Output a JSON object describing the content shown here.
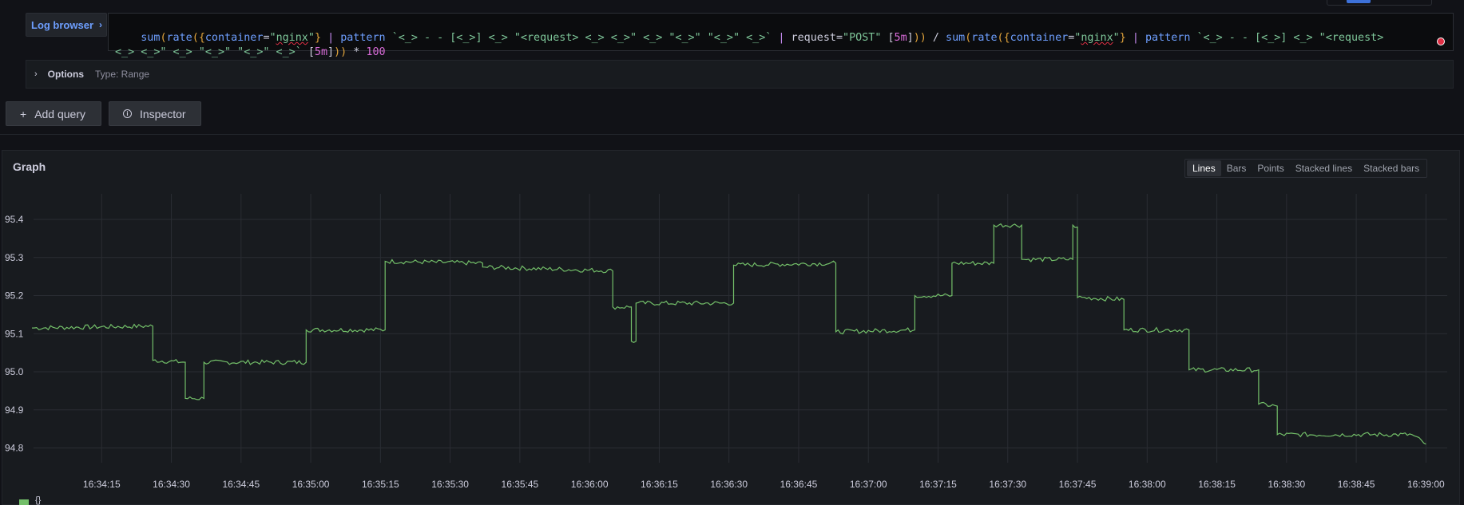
{
  "query": {
    "log_browser_label": "Log browser",
    "tokens": [
      [
        "t-fn",
        "sum"
      ],
      [
        "t-br",
        "("
      ],
      [
        "t-fn",
        "rate"
      ],
      [
        "t-br",
        "("
      ],
      [
        "t-br",
        "{"
      ],
      [
        "t-lbl",
        "container"
      ],
      [
        "t-op",
        "="
      ],
      [
        "t-str",
        "\""
      ],
      [
        "t-str t-err",
        "nginx"
      ],
      [
        "t-str",
        "\""
      ],
      [
        "t-br",
        "}"
      ],
      [
        "t-op",
        " "
      ],
      [
        "t-pipe",
        "|"
      ],
      [
        "t-op",
        " "
      ],
      [
        "t-kw",
        "pattern"
      ],
      [
        "t-op",
        " "
      ],
      [
        "t-str",
        "`<_> - - [<_>] <_> \"<request> <_> <_>\" <_> \"<_>\" \"<_>\" <_>`"
      ],
      [
        "t-op",
        " "
      ],
      [
        "t-pipe",
        "|"
      ],
      [
        "t-op",
        " request="
      ],
      [
        "t-str",
        "\"POST\""
      ],
      [
        "t-op",
        " "
      ],
      [
        "t-brk",
        "["
      ],
      [
        "t-dur",
        "5m"
      ],
      [
        "t-brk",
        "]"
      ],
      [
        "t-br",
        "))"
      ],
      [
        "t-op",
        " / "
      ],
      [
        "t-fn",
        "sum"
      ],
      [
        "t-br",
        "("
      ],
      [
        "t-fn",
        "rate"
      ],
      [
        "t-br",
        "("
      ],
      [
        "t-br",
        "{"
      ],
      [
        "t-lbl",
        "container"
      ],
      [
        "t-op",
        "="
      ],
      [
        "t-str",
        "\""
      ],
      [
        "t-str t-err",
        "nginx"
      ],
      [
        "t-str",
        "\""
      ],
      [
        "t-br",
        "}"
      ],
      [
        "t-op",
        " "
      ],
      [
        "t-pipe",
        "|"
      ],
      [
        "t-op",
        " "
      ],
      [
        "t-kw",
        "pattern"
      ],
      [
        "t-op",
        " "
      ],
      [
        "t-str",
        "`<_> - - [<_>] <_> \"<request>"
      ],
      [
        "nl",
        ""
      ],
      [
        "t-str",
        "<_> <_>\" <_> \"<_>\" \"<_>\" <_>`"
      ],
      [
        "t-op",
        " "
      ],
      [
        "t-brk",
        "["
      ],
      [
        "t-dur",
        "5m"
      ],
      [
        "t-brk",
        "]"
      ],
      [
        "t-br",
        "))"
      ],
      [
        "t-op",
        " * "
      ],
      [
        "t-num",
        "100"
      ]
    ]
  },
  "options": {
    "label": "Options",
    "type_text": "Type: Range"
  },
  "buttons": {
    "add_query": "Add query",
    "inspector": "Inspector"
  },
  "panel": {
    "title": "Graph",
    "view_options": [
      "Lines",
      "Bars",
      "Points",
      "Stacked lines",
      "Stacked bars"
    ],
    "active_view": "Lines",
    "legend_label": "{}"
  },
  "colors": {
    "series": "#73bf69",
    "grid": "#2a2d33",
    "error": "#e02f44"
  },
  "chart_data": {
    "type": "line",
    "ylim": [
      94.76,
      95.44
    ],
    "yticks": [
      "95.4",
      "95.3",
      "95.2",
      "95.1",
      "95.0",
      "94.9",
      "94.8"
    ],
    "ytick_values": [
      95.4,
      95.3,
      95.2,
      95.1,
      95.0,
      94.9,
      94.8
    ],
    "xlim_seconds": [
      0,
      302
    ],
    "xticks": [
      "16:34:15",
      "16:34:30",
      "16:34:45",
      "16:35:00",
      "16:35:15",
      "16:35:30",
      "16:35:45",
      "16:36:00",
      "16:36:15",
      "16:36:30",
      "16:36:45",
      "16:37:00",
      "16:37:15",
      "16:37:30",
      "16:37:45",
      "16:38:00",
      "16:38:15",
      "16:38:30",
      "16:38:45",
      "16:39:00"
    ],
    "xtick_seconds": [
      15,
      30,
      45,
      60,
      75,
      90,
      105,
      120,
      135,
      150,
      165,
      180,
      195,
      210,
      225,
      240,
      255,
      270,
      285,
      300
    ],
    "series": [
      {
        "name": "{}",
        "segments": [
          [
            0,
            95.115
          ],
          [
            26,
            95.12
          ],
          [
            26,
            95.03
          ],
          [
            33,
            95.025
          ],
          [
            33,
            94.93
          ],
          [
            37,
            94.93
          ],
          [
            37,
            95.025
          ],
          [
            59,
            95.025
          ],
          [
            59,
            95.11
          ],
          [
            76,
            95.11
          ],
          [
            76,
            95.29
          ],
          [
            97,
            95.285
          ],
          [
            97,
            95.275
          ],
          [
            125,
            95.265
          ],
          [
            125,
            95.17
          ],
          [
            129,
            95.17
          ],
          [
            129,
            95.08
          ],
          [
            130,
            95.08
          ],
          [
            130,
            95.18
          ],
          [
            151,
            95.18
          ],
          [
            151,
            95.28
          ],
          [
            173,
            95.285
          ],
          [
            173,
            95.105
          ],
          [
            190,
            95.11
          ],
          [
            190,
            95.2
          ],
          [
            198,
            95.2
          ],
          [
            198,
            95.285
          ],
          [
            207,
            95.285
          ],
          [
            207,
            95.385
          ],
          [
            213,
            95.385
          ],
          [
            213,
            95.295
          ],
          [
            224,
            95.295
          ],
          [
            224,
            95.385
          ],
          [
            225,
            95.38
          ],
          [
            225,
            95.195
          ],
          [
            235,
            95.19
          ],
          [
            235,
            95.11
          ],
          [
            249,
            95.11
          ],
          [
            249,
            95.005
          ],
          [
            264,
            95.005
          ],
          [
            264,
            94.915
          ],
          [
            268,
            94.91
          ],
          [
            268,
            94.835
          ],
          [
            297,
            94.835
          ],
          [
            300,
            94.81
          ]
        ]
      }
    ]
  }
}
